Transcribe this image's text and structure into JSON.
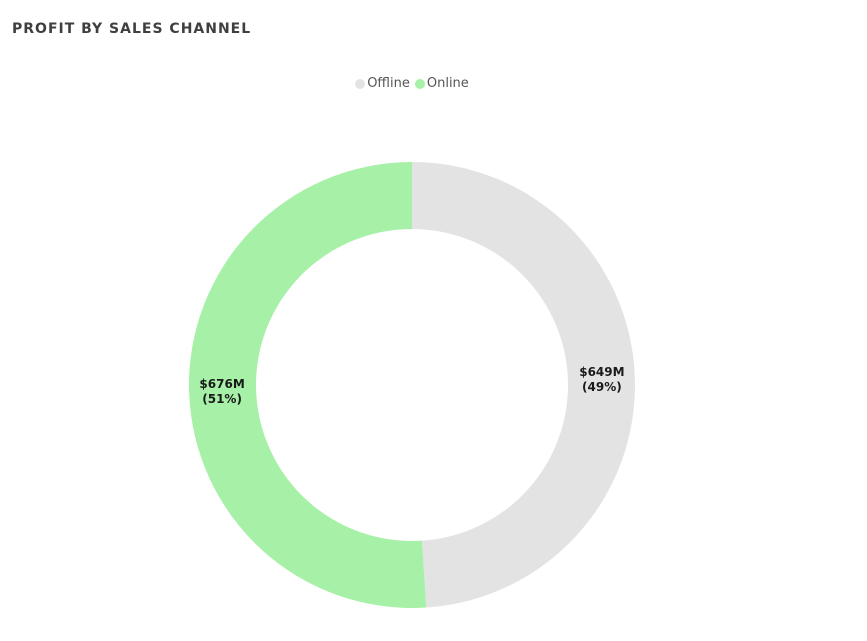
{
  "chart_data": {
    "type": "pie",
    "variant": "donut",
    "title": "PROFIT BY SALES CHANNEL",
    "legend_position": "top-center",
    "categories": [
      "Offline",
      "Online"
    ],
    "series": [
      {
        "values": [
          649,
          676
        ],
        "value_labels": [
          "$649M",
          "$676M"
        ],
        "percent_labels": [
          "(49%)",
          "(51%)"
        ]
      }
    ],
    "unit": "$M",
    "colors": {
      "Offline": "#e3e3e3",
      "Online": "#a7f0a7"
    }
  }
}
